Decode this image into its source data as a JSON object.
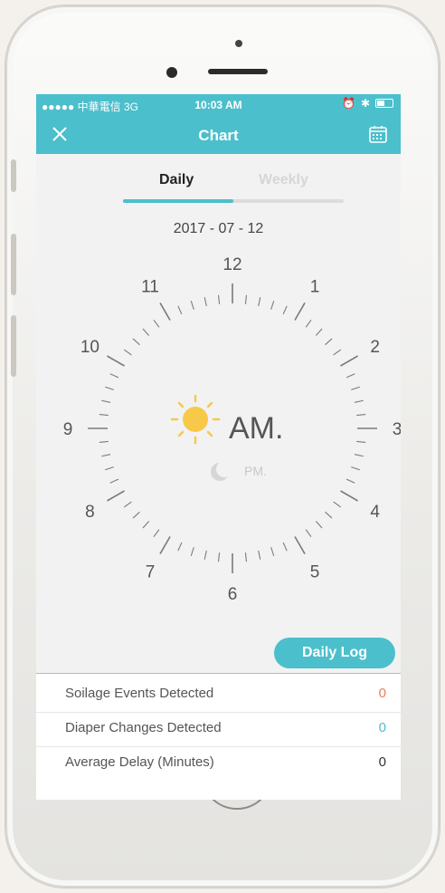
{
  "status_bar": {
    "carrier": "●●●●● 中華電信  3G",
    "time": "10:03 AM"
  },
  "nav": {
    "title": "Chart"
  },
  "tabs": [
    {
      "label": "Daily",
      "active": true
    },
    {
      "label": "Weekly",
      "active": false
    }
  ],
  "date": "2017 - 07 - 12",
  "clock": {
    "numbers": [
      "12",
      "1",
      "2",
      "3",
      "4",
      "5",
      "6",
      "7",
      "8",
      "9",
      "10",
      "11"
    ],
    "am_label": "AM.",
    "pm_label": "PM."
  },
  "daily_log_button": "Daily Log",
  "stats": [
    {
      "label": "Soilage Events Detected",
      "value": "0",
      "color": "#f07a5a"
    },
    {
      "label": "Diaper Changes Detected",
      "value": "0",
      "color": "#4bbfcc"
    },
    {
      "label": "Average Delay (Minutes)",
      "value": "0",
      "color": "#333333"
    }
  ],
  "colors": {
    "accent": "#4bbfcc",
    "sun": "#f8c948",
    "moon": "#d6d6d6"
  }
}
